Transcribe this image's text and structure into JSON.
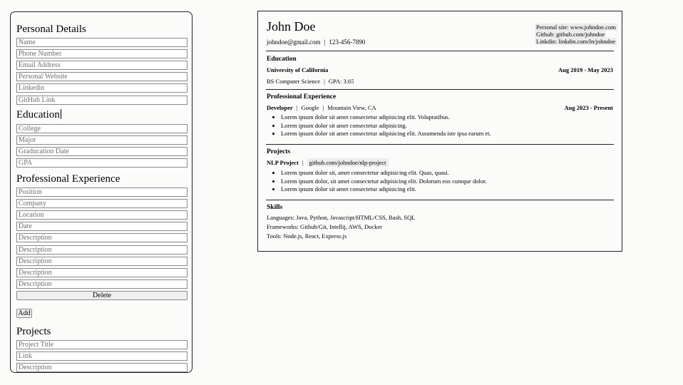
{
  "form": {
    "personal": {
      "heading": "Personal Details",
      "fields": [
        "Name",
        "Phone Number",
        "Email Address",
        "Personal Website",
        "Linkedin",
        "GitHub Link"
      ]
    },
    "education": {
      "heading": "Education",
      "fields": [
        "College",
        "Major",
        "Graducation Date",
        "GPA"
      ]
    },
    "experience": {
      "heading": "Professional Experience",
      "fields": [
        "Position",
        "Company",
        "Location",
        "Date",
        "Description",
        "Description",
        "Description",
        "Description",
        "Description"
      ],
      "delete_label": "Delete",
      "add_label": "Add"
    },
    "projects": {
      "heading": "Projects",
      "fields": [
        "Project Title",
        "Link",
        "Description"
      ]
    }
  },
  "resume": {
    "name": "John Doe",
    "email": "johndoe@gmail.com",
    "phone": "123-456-7890",
    "separator": "|",
    "links": [
      "Personal site: www.johndoe.com",
      "Github: github.com/johndoe",
      "Linkdin: linkdin.com/ln/johndoe"
    ],
    "education": {
      "heading": "Education",
      "school": "University of California",
      "dates": "Aug 2019 - May 2023",
      "degree": "BS Computer Science",
      "gpa": "GPA: 3.65"
    },
    "experience": {
      "heading": "Professional Experience",
      "position": "Developer",
      "company": "Google",
      "location": "Mountain View, CA",
      "dates": "Aug 2023 - Present",
      "bullets": [
        "Lorem ipsum dolor sit amet consectetur adipisicing elit. Voluptatibus.",
        "Lorem ipsum dolor sit amet consectetur adipisicing.",
        "Lorem ipsum dolor sit amet consectetur adipisicing elit. Assumenda iste ipsa earum et."
      ]
    },
    "projects": {
      "heading": "Projects",
      "title": "NLP Project",
      "link": "github.com/johndoe/nlp-project",
      "bullets": [
        "Lorem ipsum dolor sit, amet consectetur adipisicing elit. Quas, quasi.",
        "Lorem ipsum dolor, sit amet consectetur adipisicing elit. Dolorum eos cumque dolor.",
        "Lorem ipsum dolor sit amet consectetur adipisicing elit."
      ]
    },
    "skills": {
      "heading": "Skills",
      "languages": "Languages: Java, Python, Javascript/HTML/CSS, Bash, SQL",
      "frameworks": "Frameworks: Github/Git, Intellij, AWS, Docker",
      "tools": "Tools: Node.js, React, Express.js"
    }
  }
}
